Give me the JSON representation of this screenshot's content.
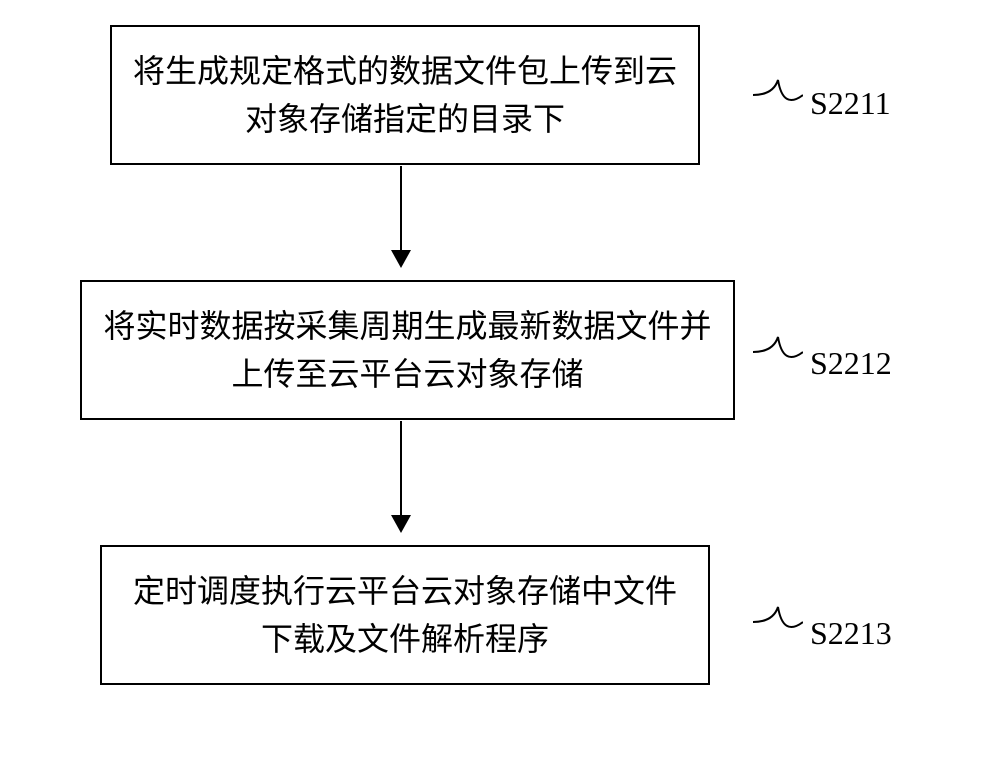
{
  "steps": [
    {
      "id": "S2211",
      "text": "将生成规定格式的数据文件包上传到云对象存储指定的目录下"
    },
    {
      "id": "S2212",
      "text": "将实时数据按采集周期生成最新数据文件并上传至云平台云对象存储"
    },
    {
      "id": "S2213",
      "text": "定时调度执行云平台云对象存储中文件下载及文件解析程序"
    }
  ]
}
